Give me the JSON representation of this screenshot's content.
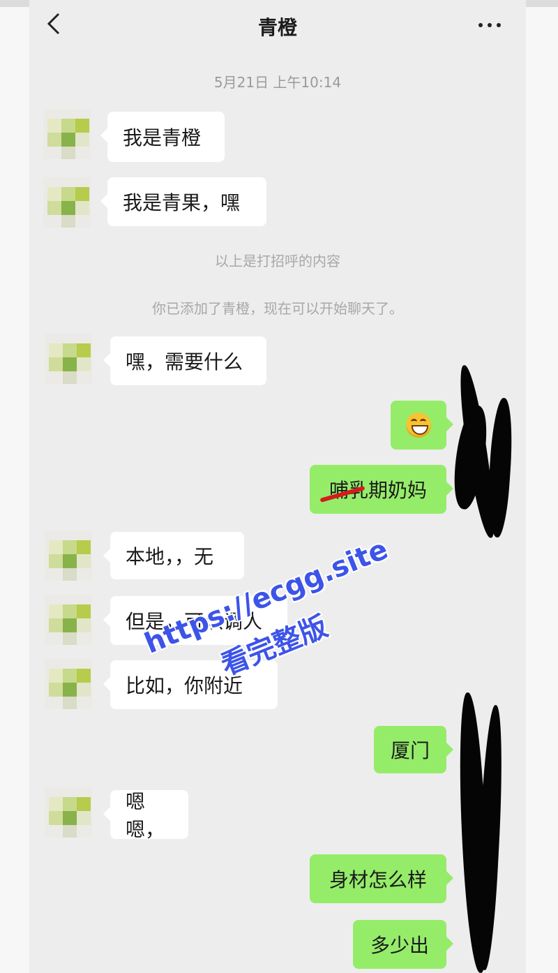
{
  "header": {
    "title": "青橙"
  },
  "timestamp": "5月21日 上午10:14",
  "system_messages": [
    "以上是打招呼的内容",
    "你已添加了青橙，现在可以开始聊天了。"
  ],
  "messages": [
    {
      "side": "left",
      "text": "我是青橙"
    },
    {
      "side": "left",
      "text": "我是青果，嘿"
    },
    {
      "side": "left",
      "text": "嘿，需要什么"
    },
    {
      "side": "right",
      "text": "",
      "emoji": "grin-emoji"
    },
    {
      "side": "right",
      "text": "哺乳期奶妈"
    },
    {
      "side": "left",
      "text": "本地，，无"
    },
    {
      "side": "left",
      "text": "但是，可以调人"
    },
    {
      "side": "left",
      "text": "比如，你附近"
    },
    {
      "side": "right",
      "text": "厦门"
    },
    {
      "side": "left",
      "text": "嗯嗯，"
    },
    {
      "side": "right",
      "text": "身材怎么样"
    },
    {
      "side": "right",
      "text": "多少出"
    }
  ],
  "watermark": {
    "line1": "https://ecgg.site",
    "line2": "看完整版"
  },
  "colors": {
    "chat_bg": "#ededed",
    "sent_bubble": "#95ec69",
    "received_bubble": "#ffffff",
    "watermark": "#3d54e8"
  }
}
